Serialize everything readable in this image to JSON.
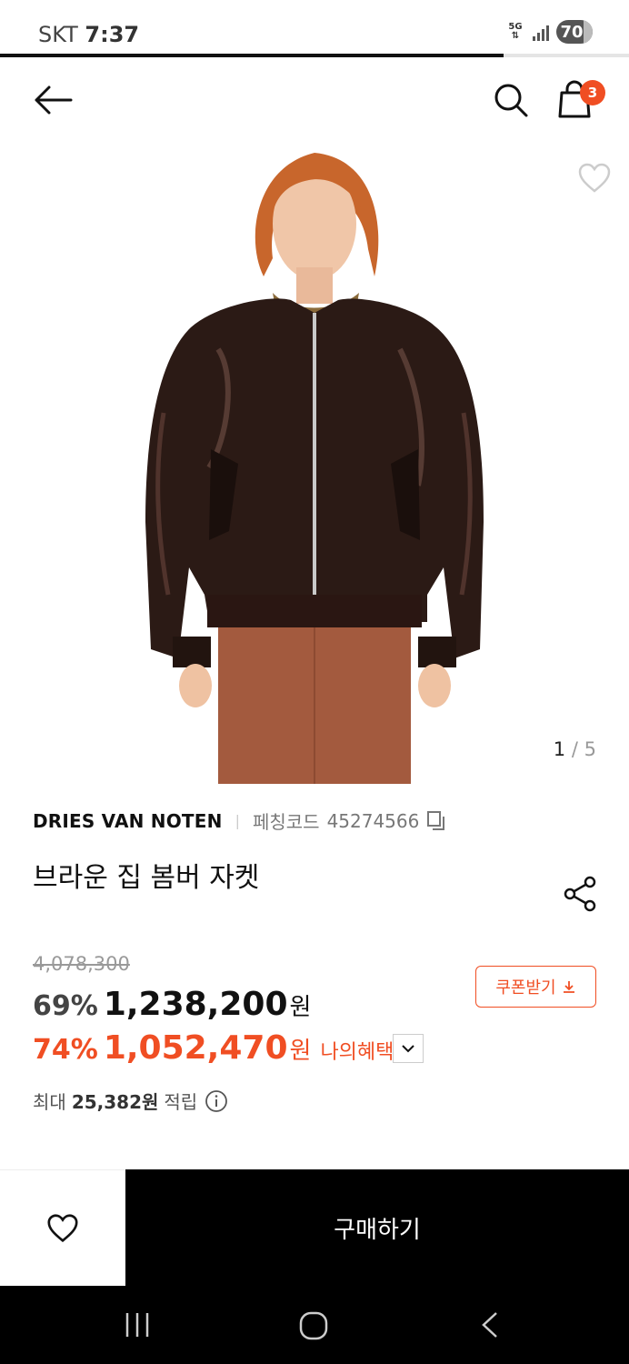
{
  "status_bar": {
    "carrier": "SKT",
    "time": "7:37",
    "network": "5G",
    "battery": "70"
  },
  "header": {
    "back_icon": "back-arrow-icon",
    "search_icon": "search-icon",
    "cart_icon": "shopping-bag-icon",
    "cart_count": "3"
  },
  "gallery": {
    "current": "1",
    "separator": "/",
    "total": "5",
    "image": "product-photo-model-brown-leather-bomber-jacket"
  },
  "product": {
    "brand": "DRIES VAN NOTEN",
    "code_label": "페칭코드",
    "code": "45274566",
    "title": "브라운 집 봄버 자켓"
  },
  "pricing": {
    "original_price": "4,078,300",
    "discount_rate": "69%",
    "sale_price": "1,238,200",
    "currency": "원",
    "benefit_rate": "74%",
    "benefit_price": "1,052,470",
    "benefit_label": "나의혜택가",
    "coupon_label": "쿠폰받기",
    "points_prefix": "최대",
    "points_value": "25,382원",
    "points_suffix": "적립"
  },
  "actions": {
    "buy_label": "구매하기",
    "wish_icon": "heart-icon"
  },
  "colors": {
    "accent": "#f04e23",
    "buy_bg": "#000000"
  }
}
